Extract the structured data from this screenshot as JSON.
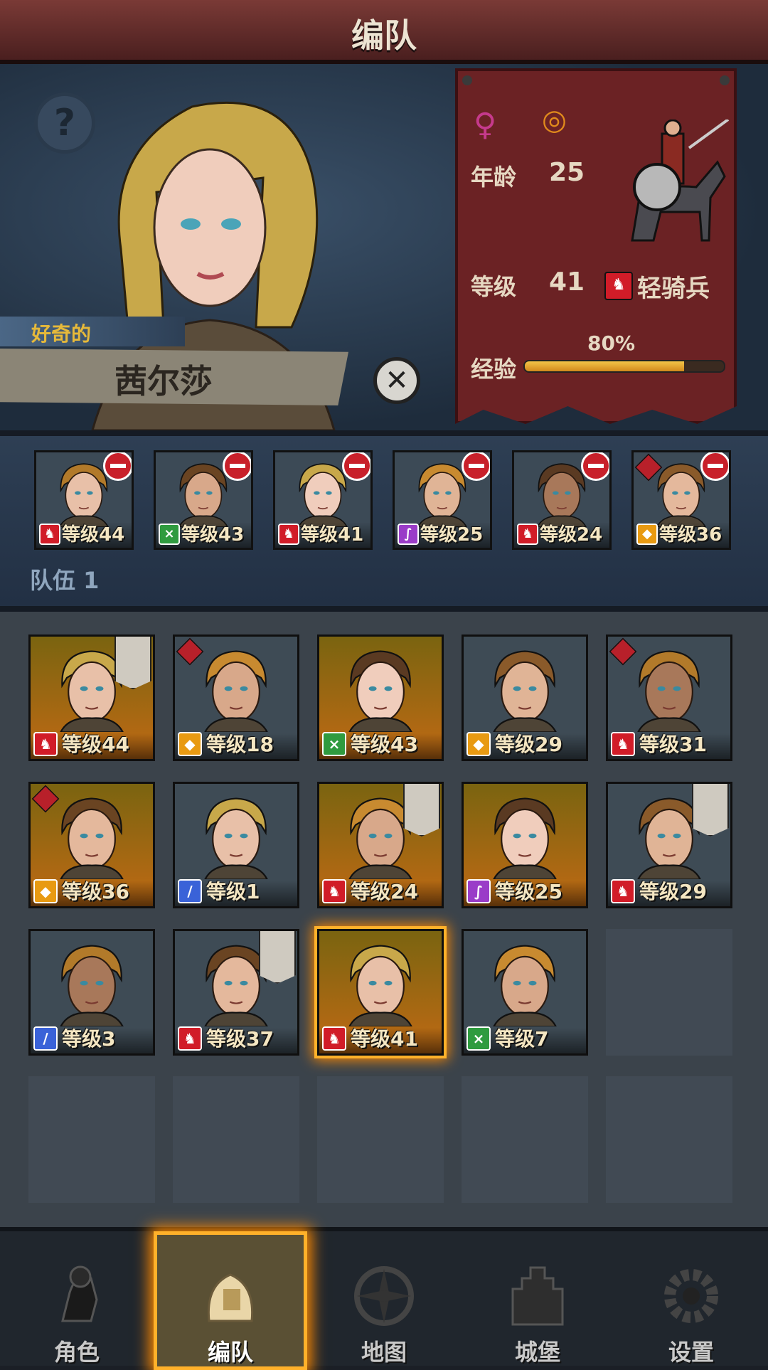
{
  "header": {
    "title": "编队"
  },
  "hero": {
    "help_symbol": "?",
    "trait": "好奇的",
    "name": "茜尔莎",
    "close_symbol": "✕",
    "gender_symbol": "♀",
    "ring_symbol": "◎",
    "age_label": "年龄",
    "age": "25",
    "level_label": "等级",
    "level": "41",
    "class_name": "轻骑兵",
    "xp_label": "经验",
    "xp_percent": "80%",
    "xp_fraction": 0.8
  },
  "team": {
    "label": "队伍 1",
    "members": [
      {
        "level": "等级44",
        "class": "red",
        "glyph": "♞"
      },
      {
        "level": "等级43",
        "class": "green",
        "glyph": "⨯"
      },
      {
        "level": "等级41",
        "class": "red",
        "glyph": "♞"
      },
      {
        "level": "等级25",
        "class": "purple",
        "glyph": "∫"
      },
      {
        "level": "等级24",
        "class": "red",
        "glyph": "♞"
      },
      {
        "level": "等级36",
        "class": "orange",
        "glyph": "◆",
        "flag": true
      }
    ]
  },
  "roster": [
    {
      "level": "等级44",
      "class": "red",
      "glyph": "♞",
      "bg": "gold",
      "banner": true
    },
    {
      "level": "等级18",
      "class": "orange",
      "glyph": "◆",
      "bg": "grey",
      "flag": true
    },
    {
      "level": "等级43",
      "class": "green",
      "glyph": "⨯",
      "bg": "gold"
    },
    {
      "level": "等级29",
      "class": "orange",
      "glyph": "◆",
      "bg": "grey"
    },
    {
      "level": "等级31",
      "class": "red",
      "glyph": "♞",
      "bg": "grey",
      "flag": true
    },
    {
      "level": "等级36",
      "class": "orange",
      "glyph": "◆",
      "bg": "gold",
      "flag": true
    },
    {
      "level": "等级1",
      "class": "blue",
      "glyph": "/",
      "bg": "grey"
    },
    {
      "level": "等级24",
      "class": "red",
      "glyph": "♞",
      "bg": "gold",
      "banner": true
    },
    {
      "level": "等级25",
      "class": "purple",
      "glyph": "∫",
      "bg": "gold"
    },
    {
      "level": "等级29",
      "class": "red",
      "glyph": "♞",
      "bg": "grey",
      "banner": true
    },
    {
      "level": "等级3",
      "class": "blue",
      "glyph": "/",
      "bg": "grey"
    },
    {
      "level": "等级37",
      "class": "red",
      "glyph": "♞",
      "bg": "grey",
      "banner": true
    },
    {
      "level": "等级41",
      "class": "red",
      "glyph": "♞",
      "bg": "gold",
      "selected": true
    },
    {
      "level": "等级7",
      "class": "green",
      "glyph": "⨯",
      "bg": "grey"
    }
  ],
  "empty_slots": 6,
  "nav": [
    {
      "label": "角色",
      "icon": "knight-icon"
    },
    {
      "label": "编队",
      "icon": "helmet-icon",
      "active": true
    },
    {
      "label": "地图",
      "icon": "compass-icon"
    },
    {
      "label": "城堡",
      "icon": "castle-icon"
    },
    {
      "label": "设置",
      "icon": "gear-icon"
    }
  ]
}
